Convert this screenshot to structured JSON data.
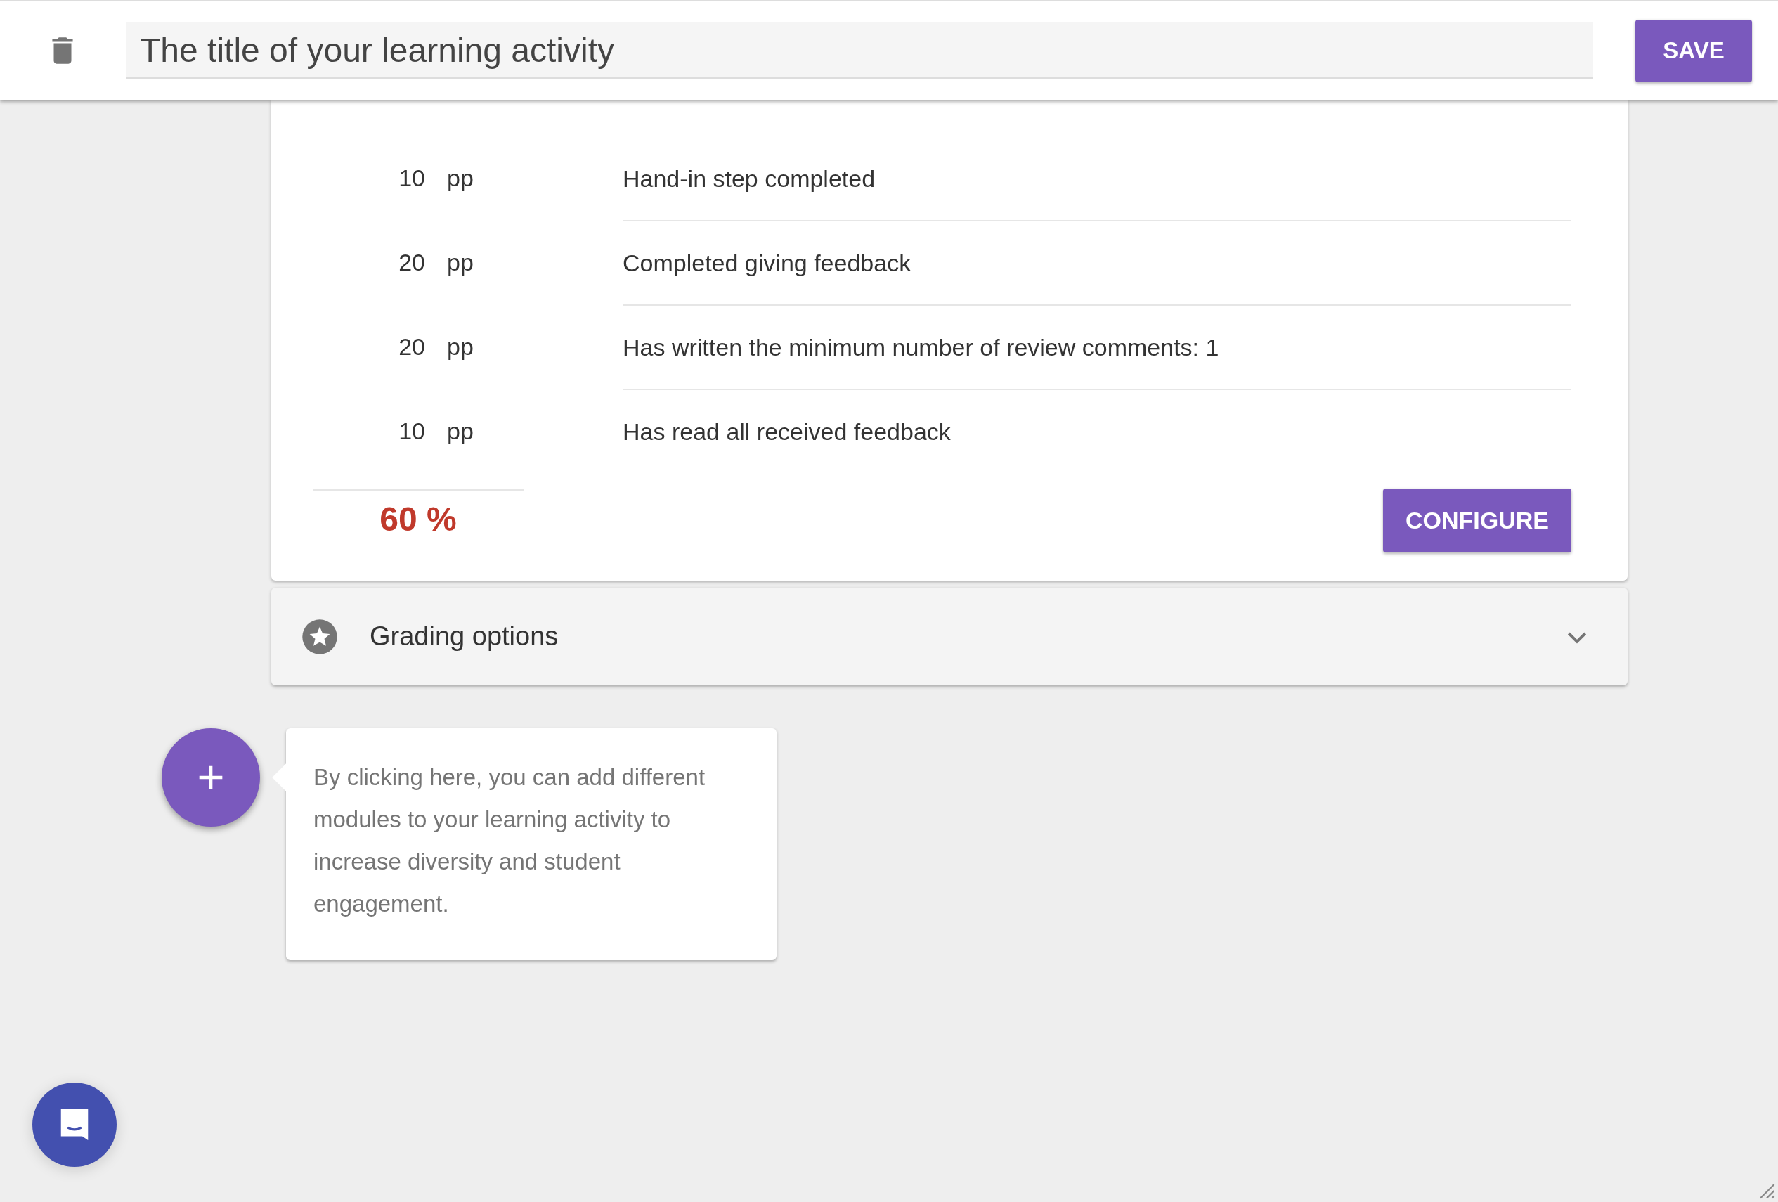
{
  "header": {
    "title_value": "The title of your learning activity",
    "save_label": "SAVE"
  },
  "criteria": [
    {
      "points": "10",
      "unit": "pp",
      "description": "Hand-in step completed"
    },
    {
      "points": "20",
      "unit": "pp",
      "description": "Completed giving feedback"
    },
    {
      "points": "20",
      "unit": "pp",
      "description": "Has written the minimum number of review comments: 1"
    },
    {
      "points": "10",
      "unit": "pp",
      "description": "Has read all received feedback"
    }
  ],
  "total": "60 %",
  "configure_label": "CONFIGURE",
  "grading_panel": {
    "label": "Grading options",
    "expanded": false
  },
  "tooltip": {
    "text": "By clicking here, you can add different modules to your learning activity to increase diversity and student engagement."
  }
}
